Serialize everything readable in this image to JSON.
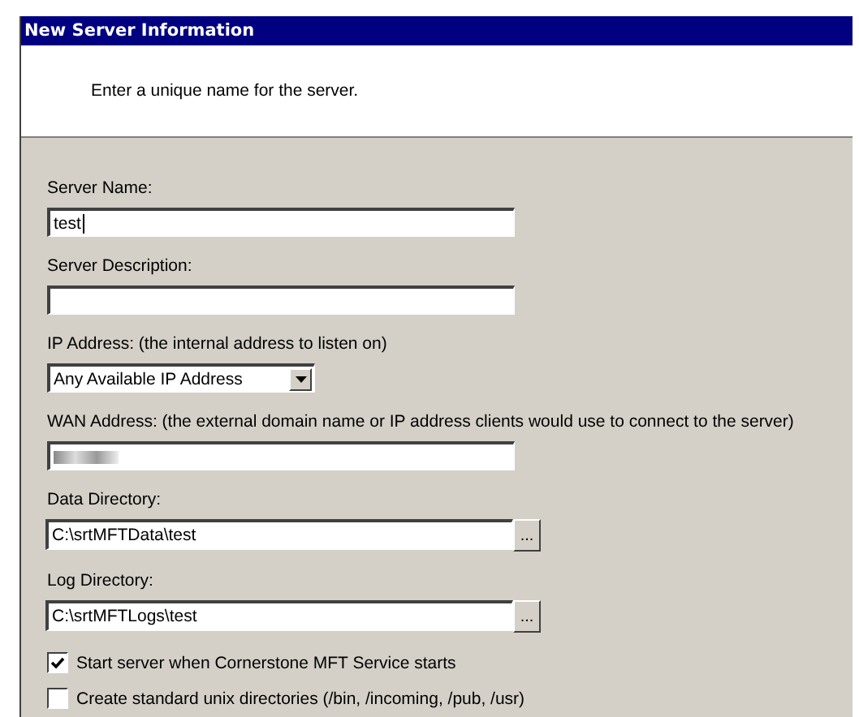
{
  "window": {
    "title": "New Server Information"
  },
  "header": {
    "instruction": "Enter a unique name for the server."
  },
  "fields": [
    {
      "kind": "text",
      "label": "Server Name:",
      "value": "test",
      "focused": true
    },
    {
      "kind": "text",
      "label": "Server Description:",
      "focused": false
    },
    {
      "kind": "select",
      "label": "IP Address: (the internal address to listen on)",
      "value": "Any Available IP Address",
      "focused": false
    },
    {
      "kind": "redacted",
      "label": "WAN Address: (the external domain name or IP address clients would use to connect to the server)",
      "focused": false
    },
    {
      "kind": "path",
      "label": "Data Directory:",
      "value": "C:\\srtMFTData\\test",
      "button": "...",
      "focused": false
    },
    {
      "kind": "path",
      "label": "Log Directory:",
      "value": "C:\\srtMFTLogs\\test",
      "button": "...",
      "focused": false
    }
  ],
  "options": [
    {
      "label": "Start server when Cornerstone MFT Service starts",
      "checked": true
    },
    {
      "label": "Create standard unix directories (/bin, /incoming, /pub, /usr)",
      "checked": false
    }
  ]
}
